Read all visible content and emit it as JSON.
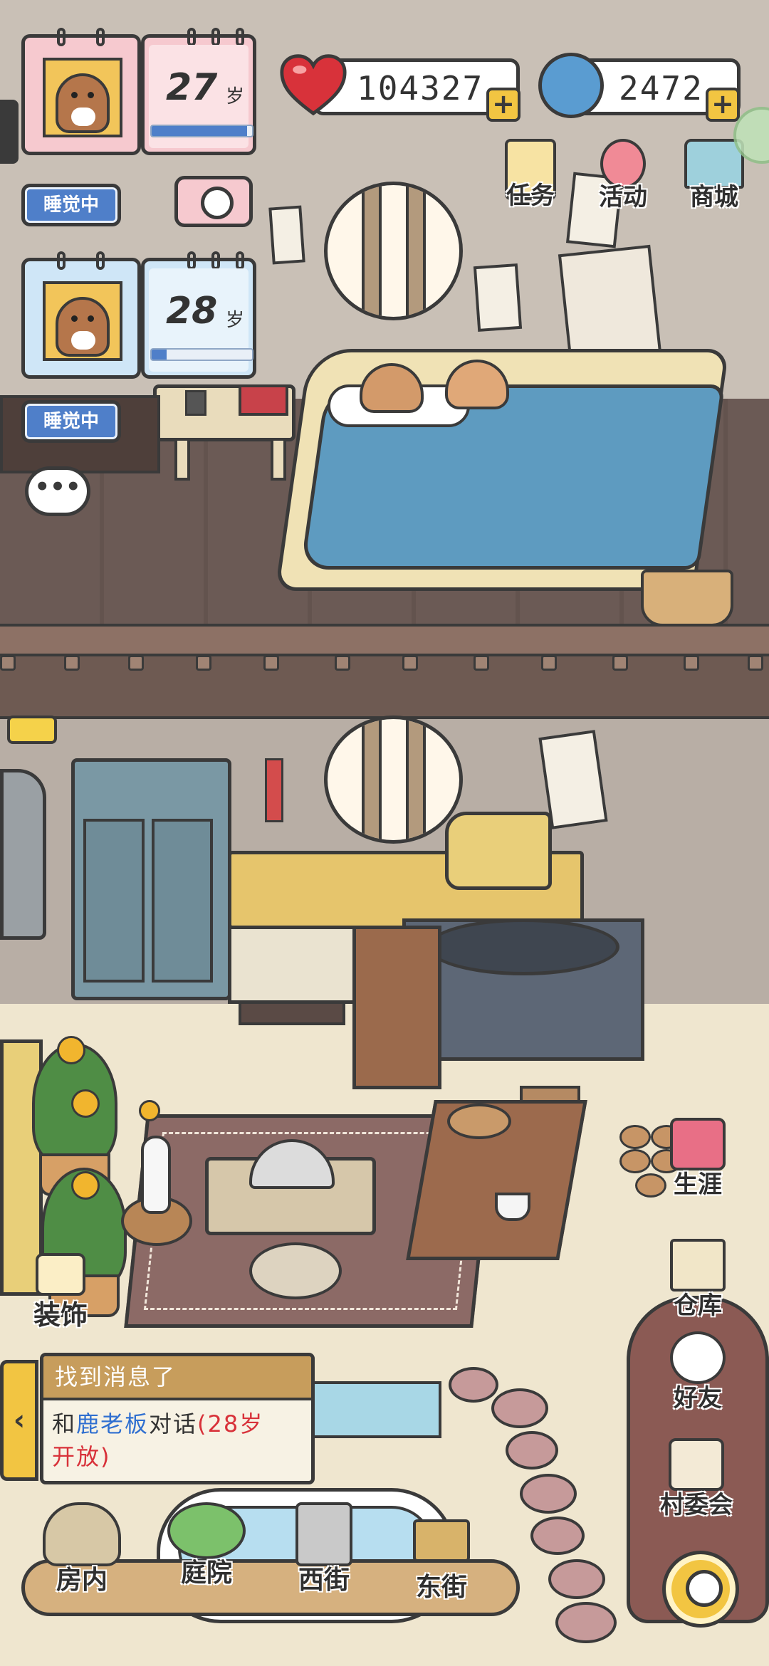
{
  "characters": [
    {
      "age": "27",
      "age_unit": "岁",
      "age_progress": 0.95,
      "status": "睡觉中",
      "card_color": "#f6c9cf"
    },
    {
      "age": "28",
      "age_unit": "岁",
      "age_progress": 0.15,
      "status": "睡觉中",
      "card_color": "#cfe6f7"
    }
  ],
  "resources": {
    "hearts": "104327",
    "coins": "2472",
    "add_label": "+"
  },
  "top_menu": [
    {
      "label": "任务",
      "icon": "task-board-icon"
    },
    {
      "label": "活动",
      "icon": "balloon-icon"
    },
    {
      "label": "商城",
      "icon": "shop-icon"
    }
  ],
  "side_menu": [
    {
      "label": "生涯",
      "icon": "book-icon"
    },
    {
      "label": "仓库",
      "icon": "warehouse-icon"
    },
    {
      "label": "好友",
      "icon": "panda-icon"
    },
    {
      "label": "村委会",
      "icon": "village-hall-icon"
    }
  ],
  "decorate": {
    "label": "装饰",
    "icon": "paint-roller-icon"
  },
  "chat": {
    "icon": "chat-bubble-icon",
    "text": "•••"
  },
  "message": {
    "title": "找到消息了",
    "line1_prefix": "和",
    "line1_name": "鹿老板",
    "line1_mid": "对话",
    "line1_note": "(28岁",
    "line2_note": "开放)",
    "toggle": "‹"
  },
  "bottom_nav": [
    {
      "label": "房内",
      "icon": "bed-icon"
    },
    {
      "label": "庭院",
      "icon": "yard-icon"
    },
    {
      "label": "西街",
      "icon": "building-icon"
    },
    {
      "label": "东街",
      "icon": "signpost-icon"
    }
  ],
  "colors": {
    "accent_blue": "#4f7fc9",
    "accent_yellow": "#f2c542",
    "heart_red": "#d8323a",
    "npc_name_blue": "#2f6fd0",
    "note_red": "#d8323a"
  }
}
